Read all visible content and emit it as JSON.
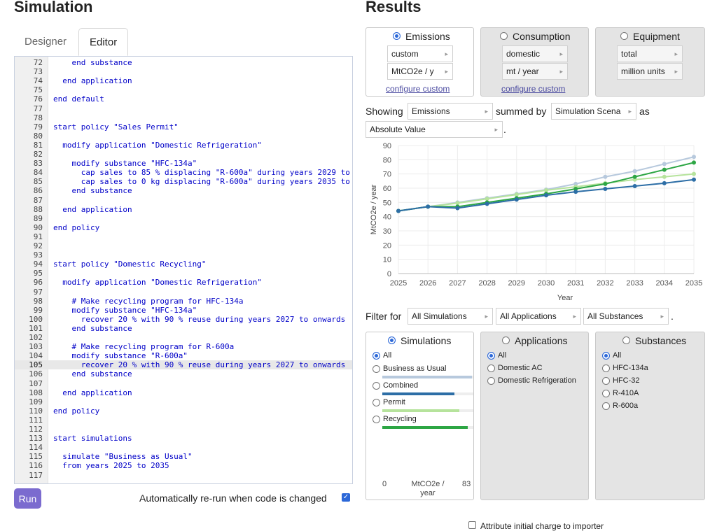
{
  "simulation": {
    "title": "Simulation",
    "tabs": [
      "Designer",
      "Editor"
    ],
    "active_tab": "Editor",
    "active_line": 105,
    "run_label": "Run",
    "auto_rerun_label": "Automatically re-run when code is changed",
    "auto_rerun_checked": true,
    "code_lines": [
      {
        "n": "72",
        "t": "    end substance"
      },
      {
        "n": "73",
        "t": ""
      },
      {
        "n": "74",
        "t": "  end application"
      },
      {
        "n": "75",
        "t": ""
      },
      {
        "n": "76",
        "t": "end default"
      },
      {
        "n": "77",
        "t": ""
      },
      {
        "n": "78",
        "t": ""
      },
      {
        "n": "79",
        "t": "start policy \"Sales Permit\""
      },
      {
        "n": "80",
        "t": ""
      },
      {
        "n": "81",
        "t": "  modify application \"Domestic Refrigeration\""
      },
      {
        "n": "82",
        "t": ""
      },
      {
        "n": "83",
        "t": "    modify substance \"HFC-134a\""
      },
      {
        "n": "84",
        "t": "      cap sales to 85 % displacing \"R-600a\" during years 2029 to"
      },
      {
        "n": "85",
        "t": "      cap sales to 0 kg displacing \"R-600a\" during years 2035 to"
      },
      {
        "n": "86",
        "t": "    end substance"
      },
      {
        "n": "87",
        "t": ""
      },
      {
        "n": "88",
        "t": "  end application"
      },
      {
        "n": "89",
        "t": ""
      },
      {
        "n": "90",
        "t": "end policy"
      },
      {
        "n": "91",
        "t": ""
      },
      {
        "n": "92",
        "t": ""
      },
      {
        "n": "93",
        "t": ""
      },
      {
        "n": "94",
        "t": "start policy \"Domestic Recycling\""
      },
      {
        "n": "95",
        "t": ""
      },
      {
        "n": "96",
        "t": "  modify application \"Domestic Refrigeration\""
      },
      {
        "n": "97",
        "t": ""
      },
      {
        "n": "98",
        "t": "    # Make recycling program for HFC-134a"
      },
      {
        "n": "99",
        "t": "    modify substance \"HFC-134a\""
      },
      {
        "n": "100",
        "t": "      recover 20 % with 90 % reuse during years 2027 to onwards"
      },
      {
        "n": "101",
        "t": "    end substance"
      },
      {
        "n": "102",
        "t": ""
      },
      {
        "n": "103",
        "t": "    # Make recycling program for R-600a"
      },
      {
        "n": "104",
        "t": "    modify substance \"R-600a\""
      },
      {
        "n": "105",
        "t": "      recover 20 % with 90 % reuse during years 2027 to onwards"
      },
      {
        "n": "106",
        "t": "    end substance"
      },
      {
        "n": "107",
        "t": ""
      },
      {
        "n": "108",
        "t": "  end application"
      },
      {
        "n": "109",
        "t": ""
      },
      {
        "n": "110",
        "t": "end policy"
      },
      {
        "n": "111",
        "t": ""
      },
      {
        "n": "112",
        "t": ""
      },
      {
        "n": "113",
        "t": "start simulations"
      },
      {
        "n": "114",
        "t": ""
      },
      {
        "n": "115",
        "t": "  simulate \"Business as Usual\""
      },
      {
        "n": "116",
        "t": "  from years 2025 to 2035"
      },
      {
        "n": "117",
        "t": ""
      }
    ]
  },
  "results": {
    "title": "Results",
    "metrics": [
      {
        "label": "Emissions",
        "selected": true,
        "select1": "custom",
        "select2": "MtCO2e / y",
        "link": "configure custom"
      },
      {
        "label": "Consumption",
        "selected": false,
        "select1": "domestic",
        "select2": "mt / year",
        "link": "configure custom"
      },
      {
        "label": "Equipment",
        "selected": false,
        "select1": "total",
        "select2": "million units",
        "link": ""
      }
    ],
    "showing_label": "Showing",
    "showing_value": "Emissions",
    "summed_label": "summed by",
    "summed_value": "Simulation Scena",
    "as_label": "as",
    "as_value": "Absolute Value",
    "period": ".",
    "filter_label": "Filter for",
    "filter_values": [
      "All Simulations",
      "All Applications",
      "All Substances"
    ],
    "filter_period": ".",
    "simulations_panel": {
      "title": "Simulations",
      "all_label": "All",
      "items": [
        {
          "label": "Business as Usual",
          "value": 82,
          "color": "#b7c9dd"
        },
        {
          "label": "Combined",
          "value": 66,
          "color": "#2d6ea6"
        },
        {
          "label": "Permit",
          "value": 70,
          "color": "#b6e39c"
        },
        {
          "label": "Recycling",
          "value": 78,
          "color": "#2da644"
        }
      ],
      "scale_min": "0",
      "scale_unit": "MtCO2e / year",
      "scale_max": "83"
    },
    "applications_panel": {
      "title": "Applications",
      "all_label": "All",
      "items": [
        "Domestic AC",
        "Domestic Refrigeration"
      ]
    },
    "substances_panel": {
      "title": "Substances",
      "all_label": "All",
      "items": [
        "HFC-134a",
        "HFC-32",
        "R-410A",
        "R-600a"
      ]
    },
    "bottom_cutoff_label": "Attribute initial charge to importer"
  },
  "chart_data": {
    "type": "line",
    "x": [
      2025,
      2026,
      2027,
      2028,
      2029,
      2030,
      2031,
      2032,
      2033,
      2034,
      2035
    ],
    "xlabel": "Year",
    "ylabel": "MtCO2e / year",
    "ylim": [
      0,
      90
    ],
    "yticks": [
      0,
      10,
      20,
      30,
      40,
      50,
      60,
      70,
      80,
      90
    ],
    "grid": true,
    "series": [
      {
        "name": "Business as Usual",
        "color": "#b7c9dd",
        "values": [
          44,
          47,
          50,
          53,
          56,
          59,
          63,
          68,
          72,
          77,
          82
        ]
      },
      {
        "name": "Permit",
        "color": "#b6e39c",
        "values": [
          44,
          47,
          49.5,
          52.5,
          55.5,
          58.5,
          61,
          63.5,
          66,
          68,
          70
        ]
      },
      {
        "name": "Recycling",
        "color": "#2da644",
        "values": [
          44,
          47,
          47,
          50,
          53,
          56,
          59.5,
          63,
          68,
          73,
          78
        ]
      },
      {
        "name": "Combined",
        "color": "#2d6ea6",
        "values": [
          44,
          47,
          46,
          49,
          52,
          55,
          57.5,
          59.5,
          61.5,
          63.5,
          66
        ]
      }
    ]
  }
}
